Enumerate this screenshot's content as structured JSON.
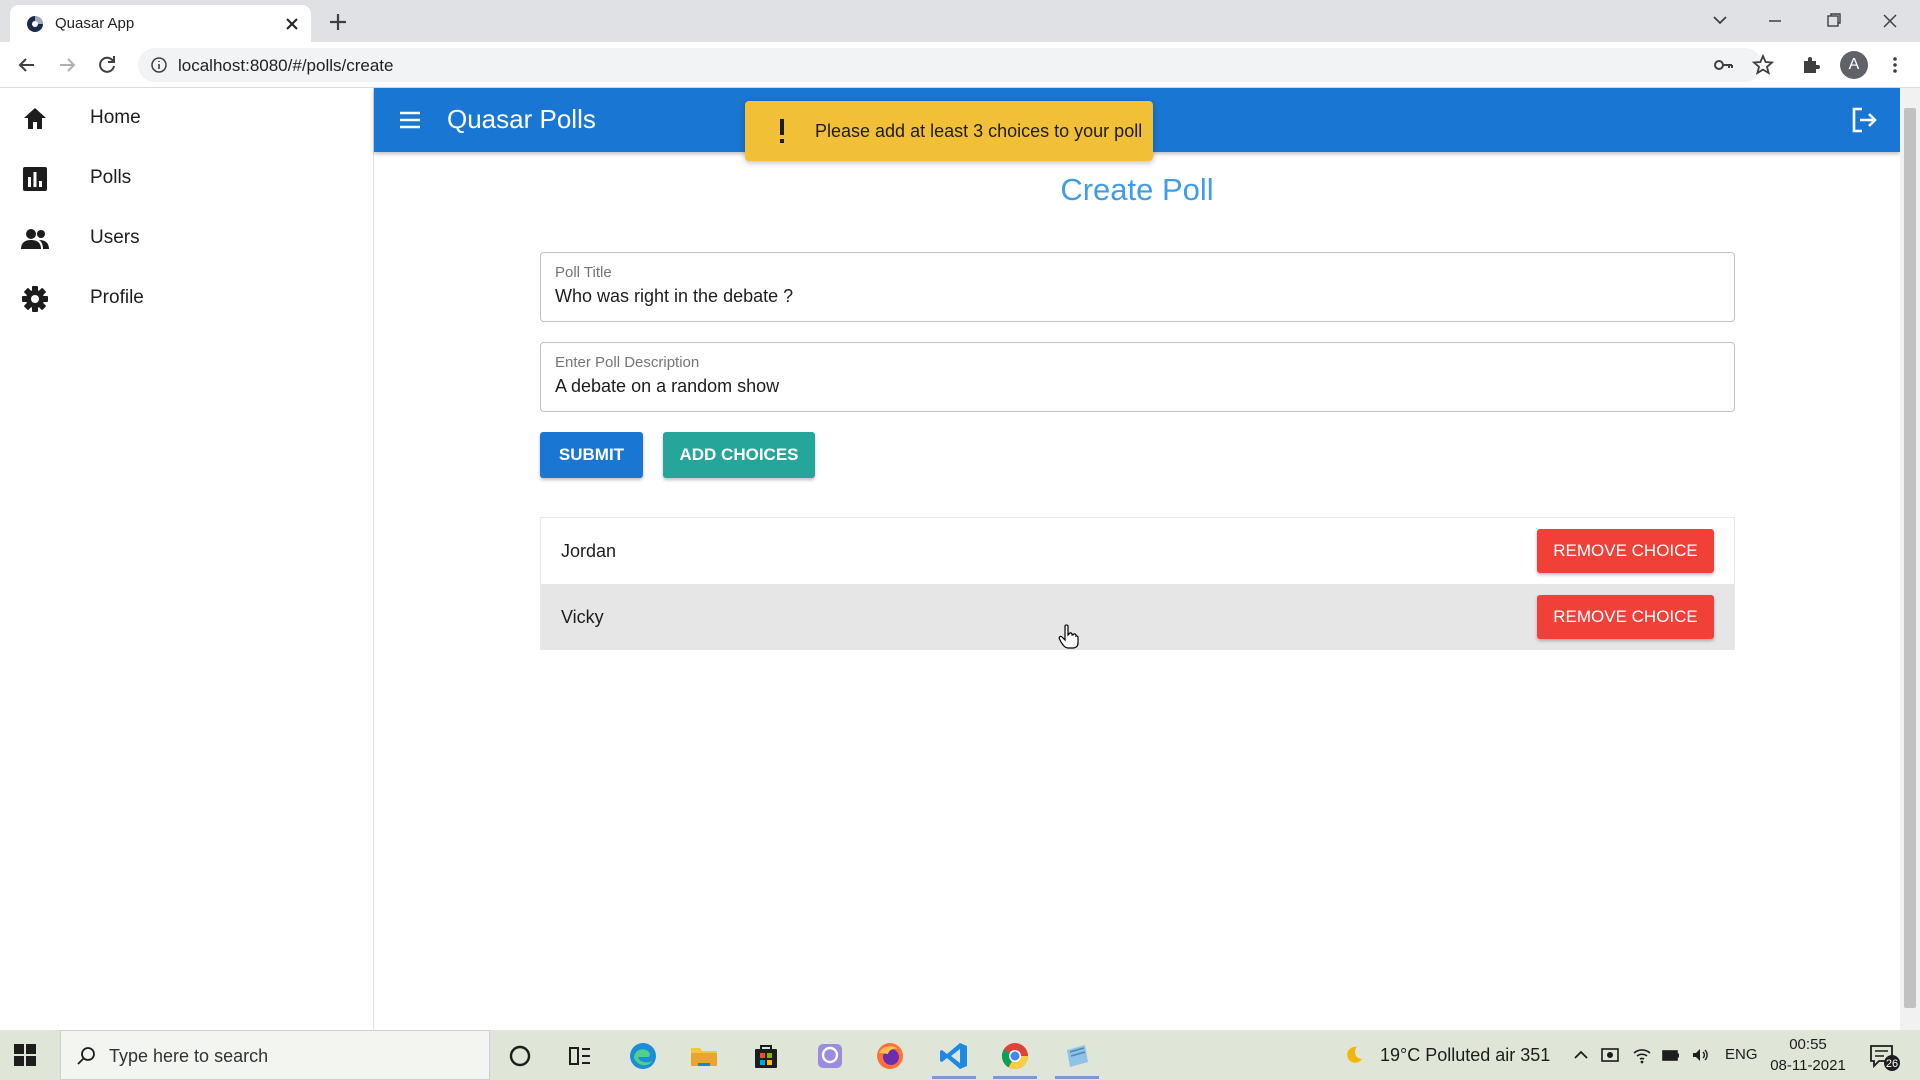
{
  "browser": {
    "tab_title": "Quasar App",
    "url": "localhost:8080/#/polls/create",
    "avatar_letter": "A"
  },
  "sidebar": {
    "items": [
      {
        "label": "Home",
        "icon": "home-icon"
      },
      {
        "label": "Polls",
        "icon": "poll-icon"
      },
      {
        "label": "Users",
        "icon": "users-icon"
      },
      {
        "label": "Profile",
        "icon": "gear-icon"
      }
    ]
  },
  "header": {
    "title": "Quasar Polls"
  },
  "notification": {
    "message": "Please add at least 3 choices to your poll",
    "color": "#f2c037"
  },
  "page": {
    "title": "Create Poll"
  },
  "form": {
    "title_label": "Poll Title",
    "title_value": "Who was right in the debate ?",
    "description_label": "Enter Poll Description",
    "description_value": "A debate on a random show",
    "submit_label": "SUBMIT",
    "add_choices_label": "ADD CHOICES"
  },
  "choices": [
    {
      "label": "Jordan",
      "button": "REMOVE CHOICE"
    },
    {
      "label": "Vicky",
      "button": "REMOVE CHOICE"
    }
  ],
  "colors": {
    "primary": "#1976d2",
    "secondary": "#26a69a",
    "negative": "#f04037",
    "title": "#3f9ce8"
  },
  "taskbar": {
    "search_placeholder": "Type here to search",
    "weather": "19°C  Polluted air 351",
    "language": "ENG",
    "time": "00:55",
    "date": "08-11-2021",
    "notifications_count": "26"
  }
}
